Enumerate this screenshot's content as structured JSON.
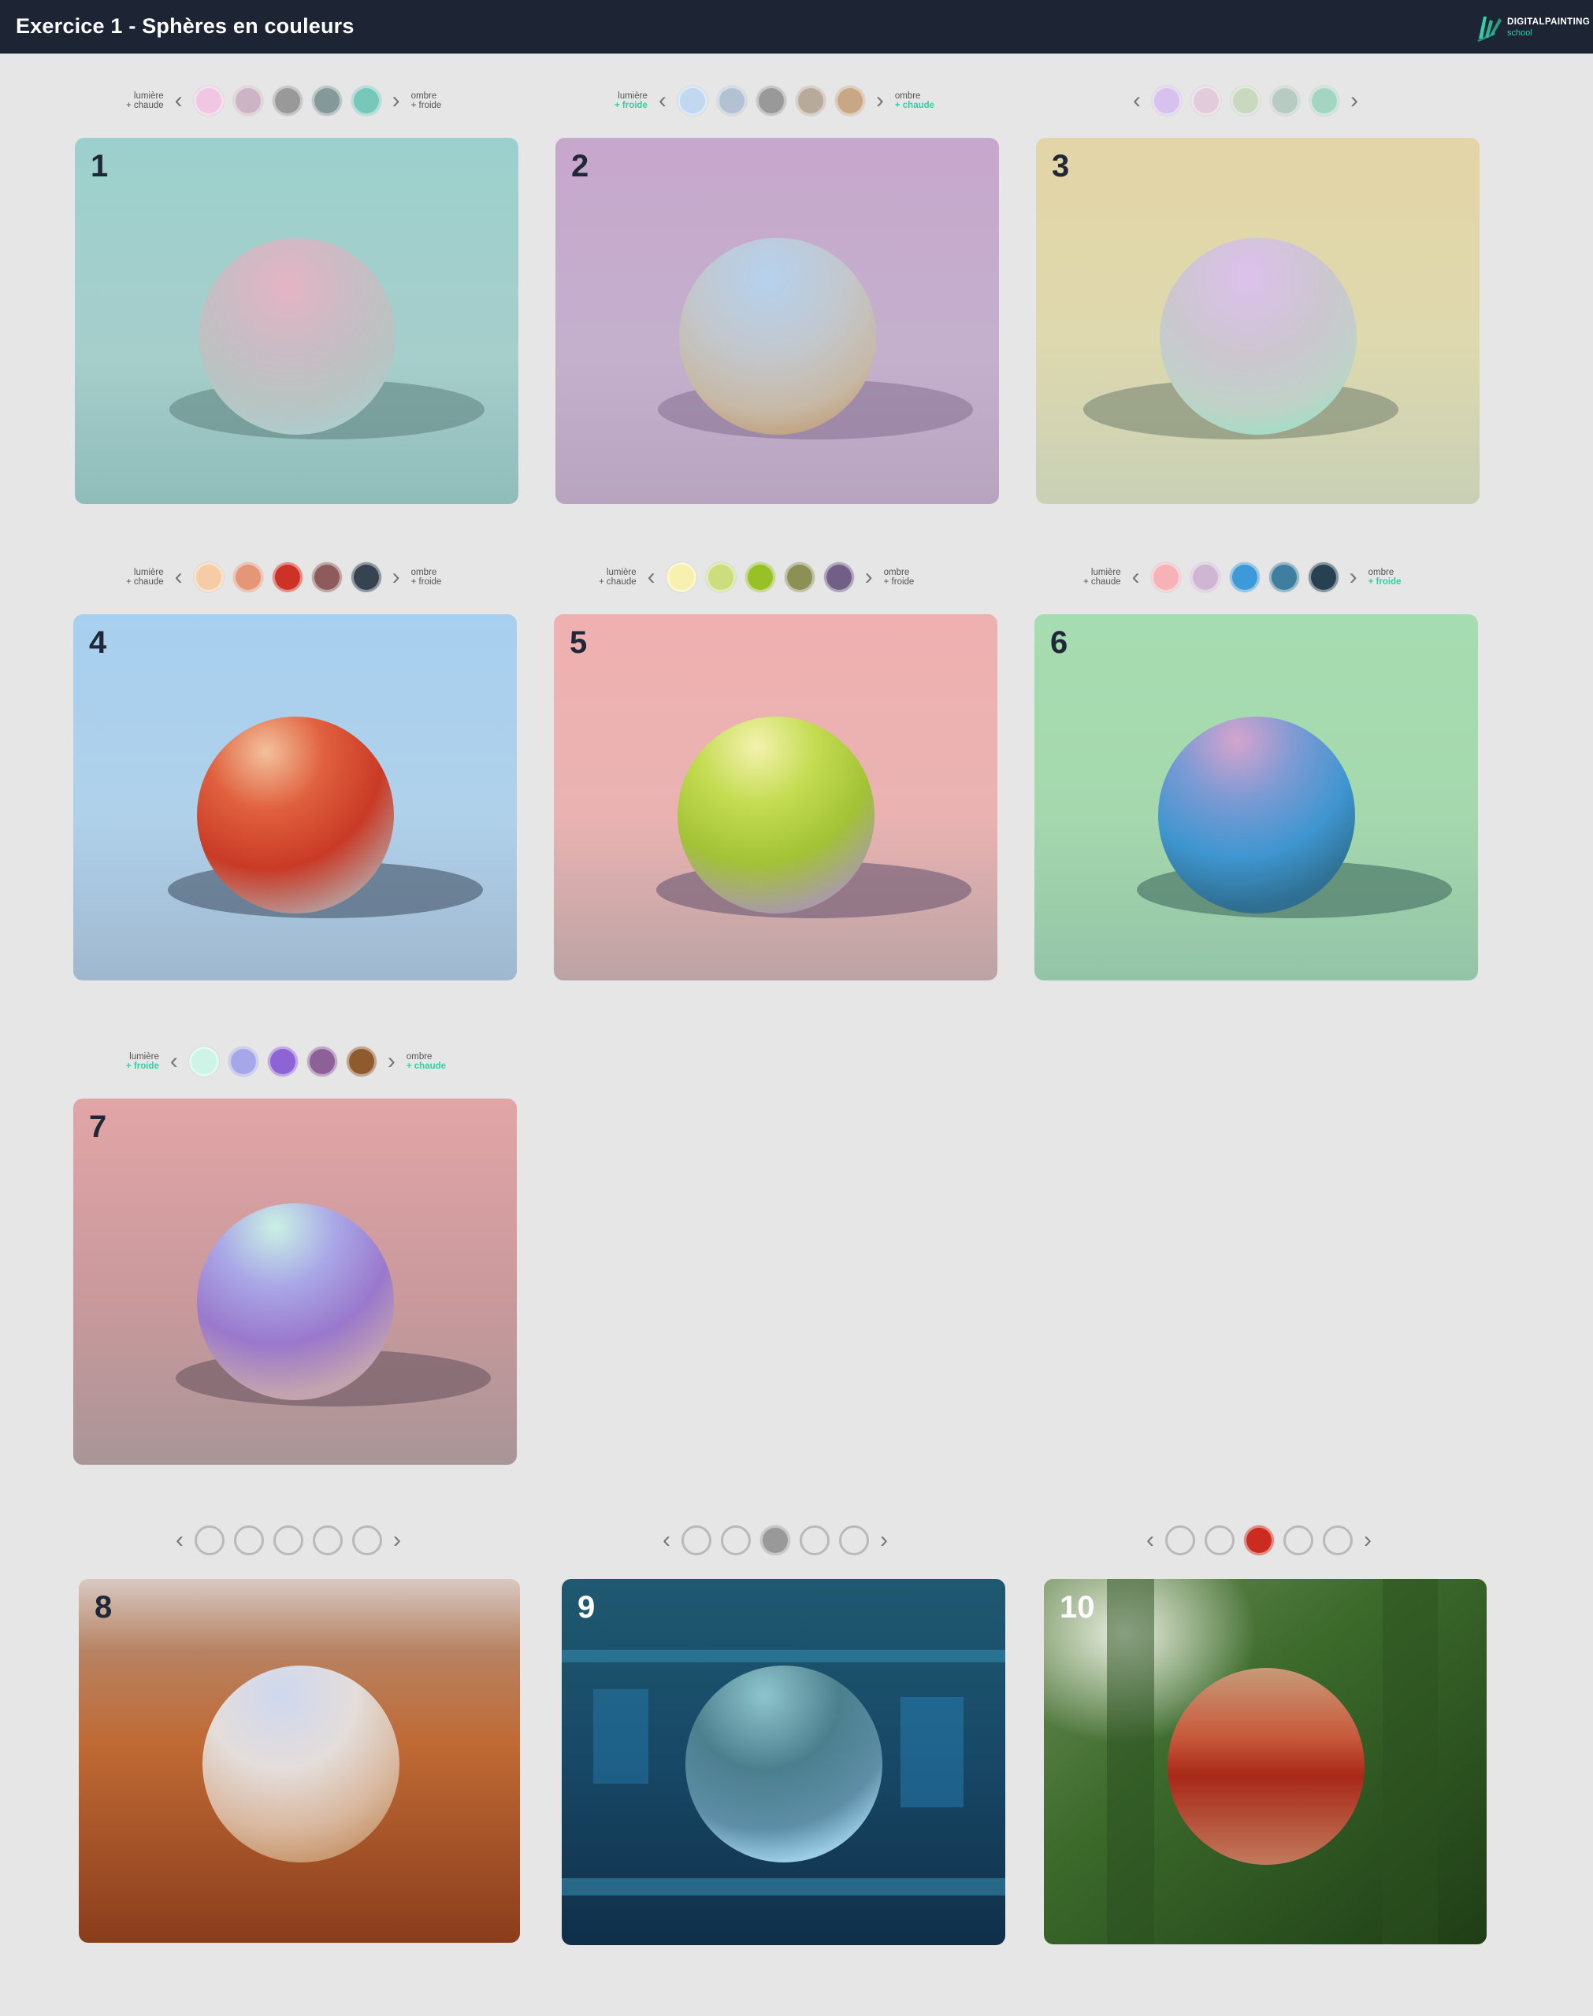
{
  "header": {
    "title": "Exercice 1 - Sphères en couleurs",
    "logo_name": "DIGITALPAINTING",
    "logo_sub": "school"
  },
  "accent_color": "#2fd0a3",
  "labels": {
    "lumiere": "lumière",
    "ombre": "ombre",
    "plus_chaude": "+ chaude",
    "plus_froide": "+ froide"
  },
  "exercises": [
    {
      "number": "1",
      "palette": [
        "#f0c6e2",
        "#cdb4c4",
        "#999999",
        "#84999a",
        "#77c7bb"
      ],
      "light_note": "+ chaude",
      "shadow_note": "+ froide",
      "light_accent": false,
      "shadow_accent": false
    },
    {
      "number": "2",
      "palette": [
        "#c1d8f1",
        "#b2c2d3",
        "#999999",
        "#b8aa9a",
        "#c7a785"
      ],
      "light_note": "+ froide",
      "shadow_note": "+ chaude",
      "light_accent": true,
      "shadow_accent": true
    },
    {
      "number": "3",
      "palette": [
        "#d6c1ef",
        "#e2ccdc",
        "#c8d9c0",
        "#b7cbc3",
        "#a4d5c2"
      ],
      "light_note": "",
      "shadow_note": "",
      "light_accent": false,
      "shadow_accent": false
    },
    {
      "number": "4",
      "palette": [
        "#f6cca6",
        "#e49677",
        "#cc3226",
        "#8e5b5c",
        "#364350"
      ],
      "light_note": "+ chaude",
      "shadow_note": "+ froide",
      "light_accent": false,
      "shadow_accent": false
    },
    {
      "number": "5",
      "palette": [
        "#f8f0ae",
        "#cbdd7c",
        "#98c027",
        "#8c9055",
        "#725f88"
      ],
      "light_note": "+ chaude",
      "shadow_note": "+ froide",
      "light_accent": false,
      "shadow_accent": false
    },
    {
      "number": "6",
      "palette": [
        "#f6b2b7",
        "#cfb7d4",
        "#3d9ad8",
        "#3e7e9f",
        "#274152"
      ],
      "light_note": "+ chaude",
      "shadow_note": "+ froide",
      "light_accent": false,
      "shadow_accent": true
    },
    {
      "number": "7",
      "palette": [
        "#cdf4e6",
        "#a5a7e8",
        "#8d63d6",
        "#8d6197",
        "#8f5a2d"
      ],
      "light_note": "+ froide",
      "shadow_note": "+ chaude",
      "light_accent": true,
      "shadow_accent": true
    },
    {
      "number": "8",
      "palette": [
        "empty",
        "empty",
        "empty",
        "empty",
        "empty"
      ]
    },
    {
      "number": "9",
      "palette": [
        "empty",
        "empty",
        "#999999",
        "empty",
        "empty"
      ]
    },
    {
      "number": "10",
      "palette": [
        "empty",
        "empty",
        "#cc2b20",
        "empty",
        "empty"
      ]
    }
  ]
}
